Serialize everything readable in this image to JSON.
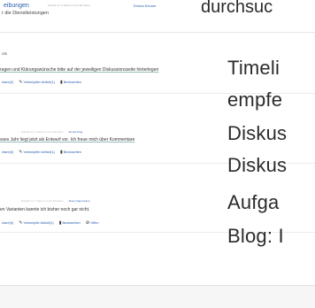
{
  "header": {
    "title": "eibungen",
    "meta": "Erstellt vor 2 Jahren und 4 Monaten",
    "user": "Emma Keuner",
    "subtitle": "r die Dienstleistungen",
    "search_word": "durchsuc"
  },
  "section": {
    "label": "ots"
  },
  "rows": [
    {
      "text": "ragen und Klärungswünsche bitte auf der jeweiligen Diskussionsseite hinterlegen",
      "meta_top": "",
      "user": "",
      "links": [
        "ntare(0)",
        "Verknüpfter Artikel(1)",
        "Beobachten"
      ],
      "sidebar_word": "Timeli"
    },
    {
      "text": "",
      "meta_top": "",
      "user": "",
      "links": [],
      "sidebar_word": "empfe"
    },
    {
      "text": "sses Jahr liegt jetzt als Entwurf vor. Ich freue mich über Kommentare",
      "meta_top": "Erstellt vor 2 Jahren und 4 Monaten",
      "user": "Annett Klug",
      "links": [
        "ntare(0)",
        "Verknüpfter Artikel(1)",
        "Beobachten"
      ],
      "sidebar_word": "Diskus"
    },
    {
      "text": "",
      "meta_top": "",
      "user": "",
      "links": [],
      "sidebar_word": "Diskus"
    },
    {
      "text": "en Varianten kannte ich bisher noch gar nicht.",
      "meta_top": "Erstellt vor 2 Jahren und 6 Monaten",
      "user": "Sissy Oppermann",
      "links": [
        "ntare(0)",
        "Verknüpfte Artikel(2)",
        "Beobachten",
        "Offen"
      ],
      "sidebar_word": "Aufga"
    },
    {
      "text": "",
      "meta_top": "",
      "user": "",
      "links": [],
      "sidebar_word": "Blog: I"
    }
  ]
}
